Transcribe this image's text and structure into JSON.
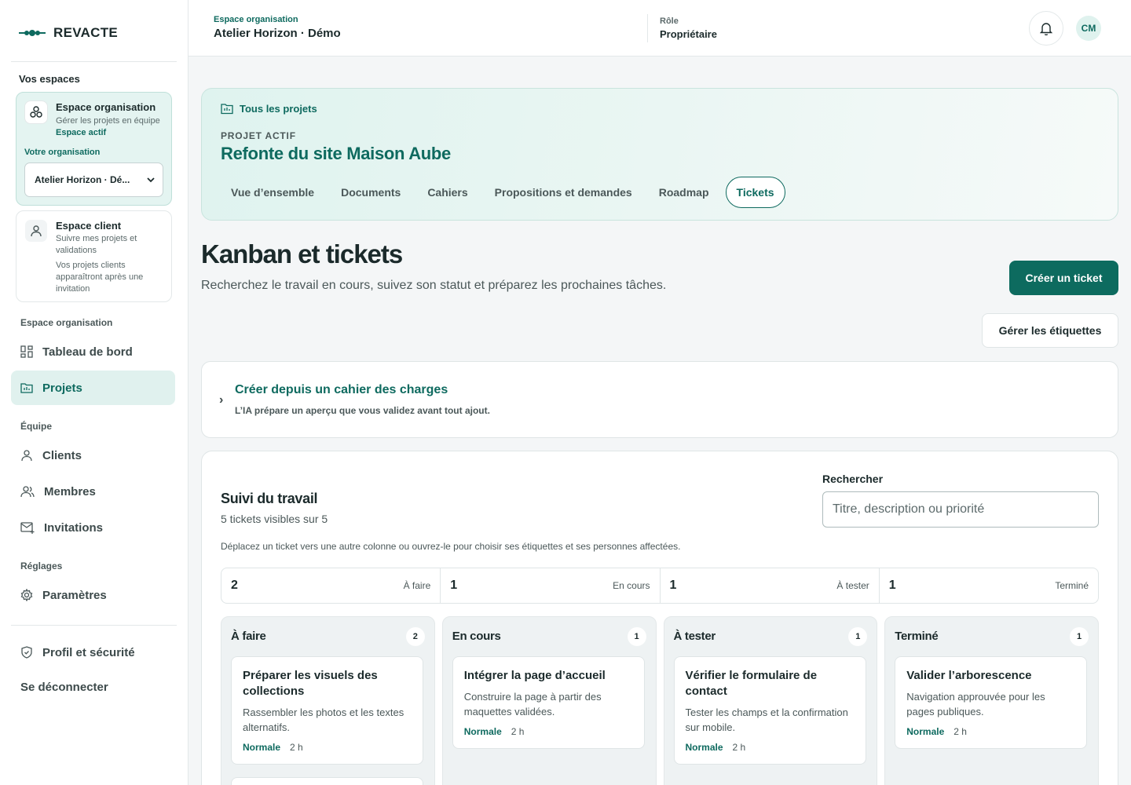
{
  "brand": {
    "name": "REVACTE"
  },
  "sidebar": {
    "spaces_heading": "Vos espaces",
    "org_space": {
      "title": "Espace organisation",
      "subtitle": "Gérer les projets en équipe",
      "badge": "Espace actif",
      "org_label": "Votre organisation",
      "org_selected": "Atelier Horizon · Dé..."
    },
    "client_space": {
      "title": "Espace client",
      "subtitle": "Suivre mes projets et validations",
      "note": "Vos projets clients apparaîtront après une invitation"
    },
    "section_org": "Espace organisation",
    "nav_dashboard": "Tableau de bord",
    "nav_projects": "Projets",
    "section_team": "Équipe",
    "nav_clients": "Clients",
    "nav_members": "Membres",
    "nav_invitations": "Invitations",
    "section_settings": "Réglages",
    "nav_settings": "Paramètres",
    "nav_profile": "Profil et sécurité",
    "nav_logout": "Se déconnecter"
  },
  "topbar": {
    "kicker": "Espace organisation",
    "title": "Atelier Horizon · Démo",
    "role_label": "Rôle",
    "role_value": "Propriétaire",
    "avatar_initials": "CM"
  },
  "project": {
    "back_link": "Tous les projets",
    "kicker": "PROJET ACTIF",
    "title": "Refonte du site Maison Aube",
    "tabs": [
      "Vue d’ensemble",
      "Documents",
      "Cahiers",
      "Propositions et demandes",
      "Roadmap",
      "Tickets"
    ],
    "active_tab": "Tickets"
  },
  "page": {
    "title": "Kanban et tickets",
    "subtitle": "Recherchez le travail en cours, suivez son statut et préparez les prochaines tâches.",
    "create_button": "Créer un ticket",
    "labels_button": "Gérer les étiquettes"
  },
  "spec": {
    "title": "Créer depuis un cahier des charges",
    "subtitle": "L’IA prépare un aperçu que vous validez avant tout ajout."
  },
  "work": {
    "title": "Suivi du travail",
    "count": "5 tickets visibles sur 5",
    "search_label": "Rechercher",
    "search_placeholder": "Titre, description ou priorité",
    "hint": "Déplacez un ticket vers une autre colonne ou ouvrez-le pour choisir ses étiquettes et ses personnes affectées.",
    "stats": [
      {
        "num": "2",
        "label": "À faire"
      },
      {
        "num": "1",
        "label": "En cours"
      },
      {
        "num": "1",
        "label": "À tester"
      },
      {
        "num": "1",
        "label": "Terminé"
      }
    ],
    "columns": [
      {
        "title": "À faire",
        "count": "2",
        "ticket": {
          "title": "Préparer les visuels des collections",
          "desc": "Rassembler les photos et les textes alternatifs.",
          "priority": "Normale",
          "estimate": "2 h"
        }
      },
      {
        "title": "En cours",
        "count": "1",
        "ticket": {
          "title": "Intégrer la page d’accueil",
          "desc": "Construire la page à partir des maquettes validées.",
          "priority": "Normale",
          "estimate": "2 h"
        }
      },
      {
        "title": "À tester",
        "count": "1",
        "ticket": {
          "title": "Vérifier le formulaire de contact",
          "desc": "Tester les champs et la confirmation sur mobile.",
          "priority": "Normale",
          "estimate": "2 h"
        }
      },
      {
        "title": "Terminé",
        "count": "1",
        "ticket": {
          "title": "Valider l’arborescence",
          "desc": "Navigation approuvée pour les pages publiques.",
          "priority": "Normale",
          "estimate": "2 h"
        }
      }
    ]
  },
  "colors": {
    "accent": "#0d6b5f",
    "accent_light": "#e0f1ee",
    "background": "#f4f6f7"
  }
}
